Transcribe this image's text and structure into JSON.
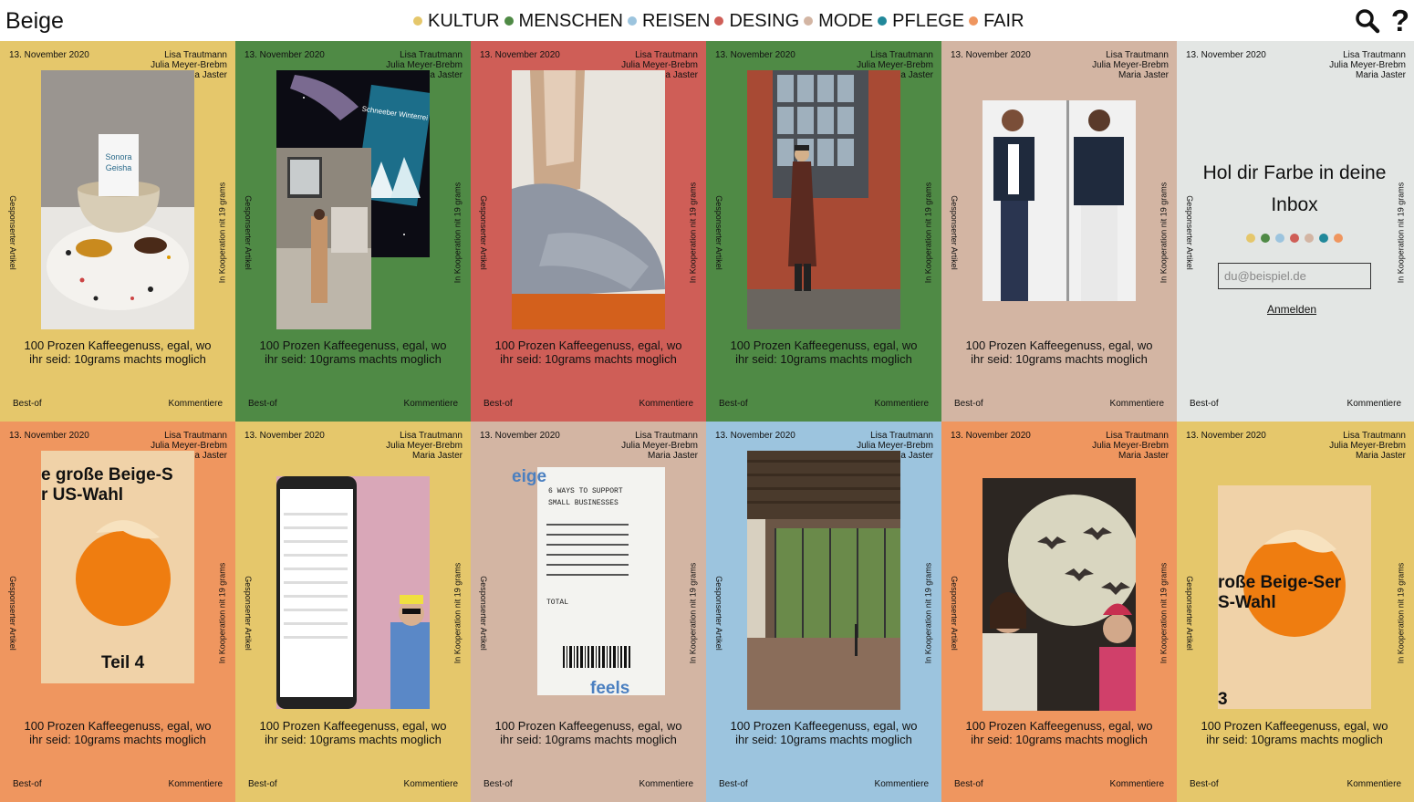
{
  "header": {
    "logo": "Beige",
    "nav": [
      {
        "label": "KULTUR",
        "color": "#e5c76b"
      },
      {
        "label": "MENSCHEN",
        "color": "#4f8a45"
      },
      {
        "label": "REISEN",
        "color": "#9cc4de"
      },
      {
        "label": "DESING",
        "color": "#cf5e57"
      },
      {
        "label": "MODE",
        "color": "#d3b5a3"
      },
      {
        "label": "PFLEGE",
        "color": "#21889a"
      },
      {
        "label": "FAIR",
        "color": "#ef965f"
      }
    ],
    "search_icon": "search-icon",
    "help_icon": "question-icon",
    "help_glyph": "?"
  },
  "card_template": {
    "date": "13. November 2020",
    "author1": "Lisa Trautmann",
    "author2": "Julia Meyer-Brebm",
    "author3": "Maria Jaster",
    "left_vertical": "Gesponserter Artikel",
    "right_vertical": "In Kooperation nit 19 grams",
    "title": "100 Prozen Kaffeegenuss, egal, wo ihr seid: 10grams machts moglich",
    "bestof": "Best-of",
    "comments": "Kommentiere"
  },
  "card_colors": [
    "#e5c76b",
    "#4f8a45",
    "#cf5e57",
    "#4f8a45",
    "#d3b5a3",
    "#e3e6e4",
    "#ef965f",
    "#e5c76b",
    "#d3b5a3",
    "#9cc4de",
    "#ef965f",
    "#e5c76b"
  ],
  "card_images": {
    "c7_line1": "e große Beige-S",
    "c7_line2": "r US-Wahl",
    "c7_line3": "Teil 4",
    "c9_head": "6 WAYS TO SUPPORT SMALL BUSINESSES",
    "c9_word1": "eige",
    "c9_word2": "feels",
    "c9_total": "TOTAL",
    "c12_line1": "roße Beige-Ser",
    "c12_line2": "S-Wahl",
    "c12_num": "3",
    "c2_sign": "Schneeber Winterrei"
  },
  "newsletter": {
    "heading": "Hol dir Farbe in deine Inbox",
    "placeholder": "du@beispiel.de",
    "button": "Anmelden",
    "dot_colors": [
      "#e5c76b",
      "#4f8a45",
      "#9cc4de",
      "#cf5e57",
      "#d3b5a3",
      "#21889a",
      "#ef965f"
    ]
  }
}
